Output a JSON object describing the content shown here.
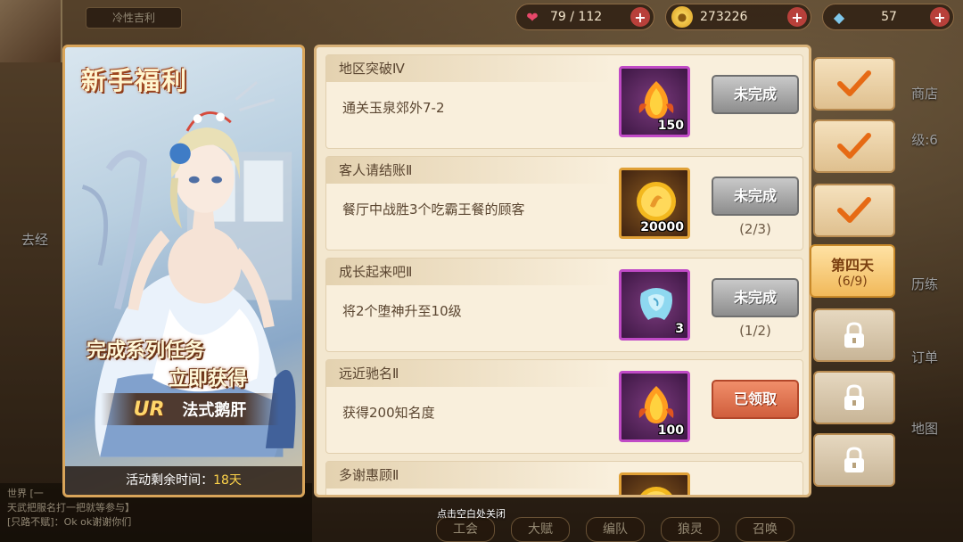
{
  "topbar": {
    "hp": "79 / 112",
    "gold": "273226",
    "gems": "57",
    "plus": "+"
  },
  "player": {
    "name": "冷性吉利"
  },
  "side_menu": {
    "shop": "商店",
    "train": "历练",
    "orders": "订单",
    "map": "地图",
    "go_out": "去经",
    "level": "级:6"
  },
  "bottom_bar": [
    "工会",
    "大赋",
    "编队",
    "狼灵",
    "召唤"
  ],
  "chat": {
    "lines": [
      "世界 [一",
      "天武把服名打一把就等参与】",
      "[只路不赋]：Ok ok谢谢你们"
    ]
  },
  "close_hint": "点击空白处关闭",
  "card": {
    "title": "新手福利",
    "slogan_line1": "完成系列任务",
    "slogan_line2": "立即获得",
    "rarity": "UR",
    "hero_name": "法式鹅肝",
    "timer_label": "活动剩余时间：",
    "timer_value": "18天"
  },
  "tasks": [
    {
      "title": "地区突破Ⅳ",
      "desc": "通关玉泉郊外7-2",
      "reward_icon": "fire-seed-icon",
      "reward_qty": "150",
      "reward_frame": "purple",
      "status": "未完成",
      "status_type": "incomplete",
      "progress": ""
    },
    {
      "title": "客人请结账Ⅱ",
      "desc": "餐厅中战胜3个吃霸王餐的顾客",
      "reward_icon": "gold-coin-icon",
      "reward_qty": "20000",
      "reward_frame": "orange",
      "status": "未完成",
      "status_type": "incomplete",
      "progress": "(2/3)"
    },
    {
      "title": "成长起来吧Ⅱ",
      "desc": "将2个堕神升至10级",
      "reward_icon": "crystal-shard-icon",
      "reward_qty": "3",
      "reward_frame": "purple",
      "status": "未完成",
      "status_type": "incomplete",
      "progress": "(1/2)"
    },
    {
      "title": "远近驰名Ⅱ",
      "desc": "获得200知名度",
      "reward_icon": "fire-seed-icon",
      "reward_qty": "100",
      "reward_frame": "purple",
      "status": "已领取",
      "status_type": "claimed",
      "progress": ""
    },
    {
      "title": "多谢惠顾Ⅱ",
      "desc": "",
      "reward_icon": "gold-coin-icon",
      "reward_qty": "",
      "reward_frame": "orange",
      "status": "",
      "status_type": "claimed",
      "progress": ""
    }
  ],
  "day_tabs": [
    {
      "state": "done"
    },
    {
      "state": "done"
    },
    {
      "state": "done"
    },
    {
      "state": "active",
      "label": "第四天",
      "progress": "(6/9)"
    },
    {
      "state": "locked"
    },
    {
      "state": "locked"
    },
    {
      "state": "locked"
    }
  ],
  "colors": {
    "accent_orange": "#e8892e",
    "claimed_red": "#d05e3c",
    "incomplete_gray": "#9a9a9a",
    "panel_bg": "#f3e7cf"
  }
}
